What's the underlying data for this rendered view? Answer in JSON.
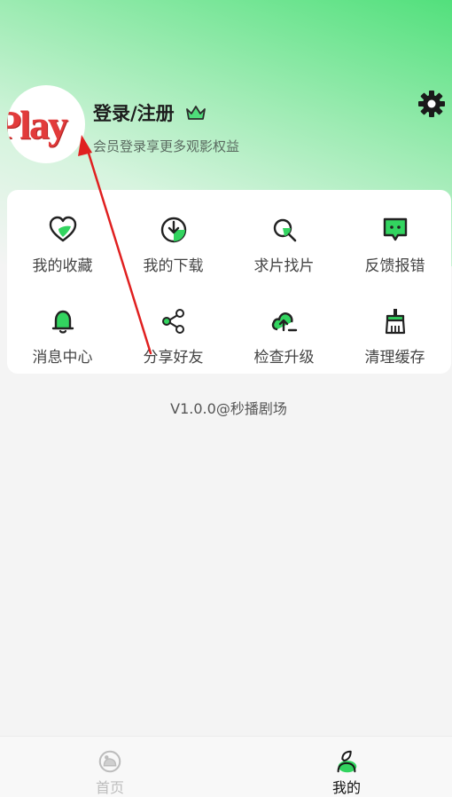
{
  "profile": {
    "avatar_text": "Play",
    "login_label": "登录/注册",
    "subtitle": "会员登录享更多观影权益"
  },
  "menu": [
    {
      "label": "我的收藏",
      "icon": "heart-icon"
    },
    {
      "label": "我的下载",
      "icon": "download-icon"
    },
    {
      "label": "求片找片",
      "icon": "search-icon"
    },
    {
      "label": "反馈报错",
      "icon": "feedback-icon"
    },
    {
      "label": "消息中心",
      "icon": "bell-icon"
    },
    {
      "label": "分享好友",
      "icon": "share-icon"
    },
    {
      "label": "检查升级",
      "icon": "upgrade-icon"
    },
    {
      "label": "清理缓存",
      "icon": "broom-icon"
    }
  ],
  "version": "V1.0.0@秒播剧场",
  "bottom_nav": [
    {
      "label": "首页",
      "icon": "home-icon",
      "active": false
    },
    {
      "label": "我的",
      "icon": "profile-icon",
      "active": true
    }
  ],
  "colors": {
    "accent": "#32d45f",
    "annotation_arrow": "#e02020"
  }
}
